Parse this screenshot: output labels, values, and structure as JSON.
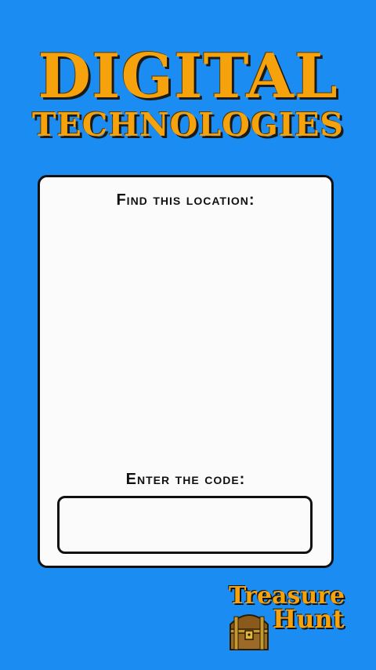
{
  "header": {
    "title": "DIGITAL",
    "subtitle": "TECHNOLOGIES"
  },
  "card": {
    "find_label": "Find this location:",
    "code_label": "Enter the code:",
    "code_input": {
      "value": "",
      "placeholder": ""
    }
  },
  "logo": {
    "line1": "Treasure",
    "line2": "Hunt",
    "icon": "treasure-chest-icon"
  },
  "colors": {
    "background": "#1b8cf2",
    "title_gold": "#f5a20d",
    "card": "#fbfbfb",
    "border": "#111111"
  }
}
